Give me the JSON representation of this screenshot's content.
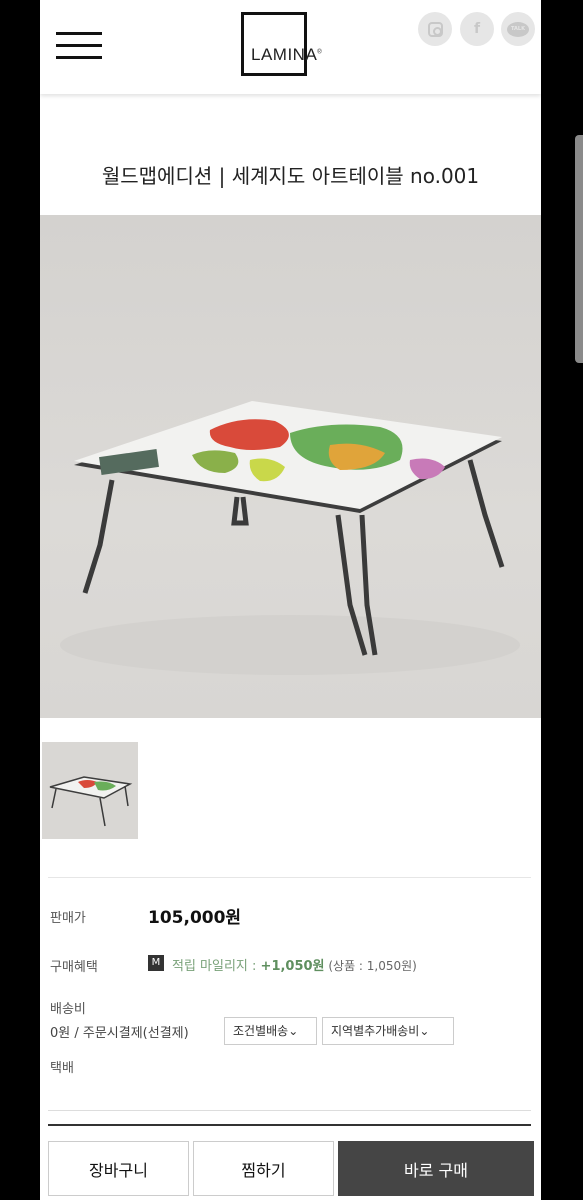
{
  "header": {
    "logo": "LAMINA",
    "logo_sup": "®",
    "social": {
      "facebook_glyph": "f",
      "kakao_glyph": "TALK"
    }
  },
  "product": {
    "title": "월드맵에디션 | 세계지도 아트테이블 no.001"
  },
  "info": {
    "price_label": "판매가",
    "price": "105,000원",
    "benefit_label": "구매혜택",
    "badge": "M",
    "mileage_prefix": "적립 마일리지 : ",
    "mileage_value": "+1,050원",
    "mileage_extra": " (상품 : 1,050원)",
    "shipping_label": "배송비",
    "shipping_text": "0원  / 주문시결제(선결제)",
    "select_1": "조건별배송⌄",
    "select_2": "지역별추가배송비⌄",
    "delivery_type": "택배"
  },
  "actions": {
    "cart": "장바구니",
    "wishlist": "찜하기",
    "buy_now": "바로 구매"
  }
}
